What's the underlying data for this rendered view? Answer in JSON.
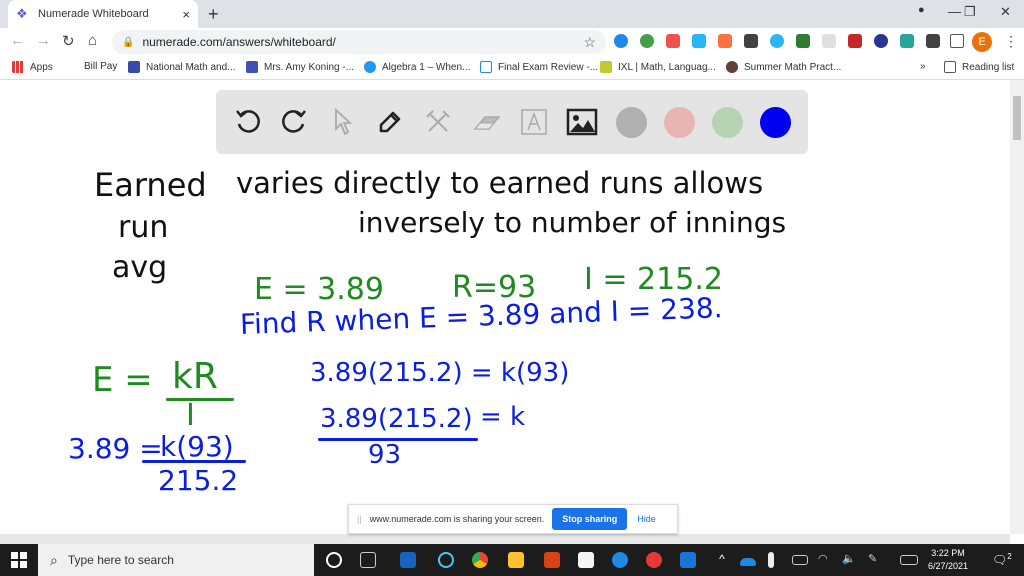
{
  "browser": {
    "tab_title": "Numerade Whiteboard",
    "tab_close": "×",
    "new_tab": "+",
    "url": "numerade.com/answers/whiteboard/",
    "window_controls": {
      "minimize": "—",
      "restore": "❐",
      "close": "✕"
    },
    "profile_initial": "E",
    "icons": {
      "back": "←",
      "forward": "→",
      "reload": "↻",
      "home": "⌂",
      "lock": "🔒",
      "star": "☆",
      "menu": "⋮",
      "media": "●"
    }
  },
  "bookmarks": {
    "items": [
      {
        "label": "Apps",
        "color": "#e53935"
      },
      {
        "label": "Bill Pay",
        "color": ""
      },
      {
        "label": "National Math and...",
        "color": "#3949ab"
      },
      {
        "label": "Mrs. Amy Koning -...",
        "color": "#3f51b5"
      },
      {
        "label": "Algebra 1 – When...",
        "color": "#2196f3"
      },
      {
        "label": "Final Exam Review -...",
        "color": "#1e88e5"
      },
      {
        "label": "IXL | Math, Languag...",
        "color": "#c0ca33"
      },
      {
        "label": "Summer Math Pract...",
        "color": "#5d4037"
      }
    ],
    "overflow": "»",
    "reading_list": "Reading list"
  },
  "whiteboard": {
    "tools": [
      {
        "name": "undo",
        "glyph": "↺",
        "enabled": true
      },
      {
        "name": "redo",
        "glyph": "↻",
        "enabled": true
      },
      {
        "name": "select",
        "glyph": "➚",
        "enabled": false
      },
      {
        "name": "pen",
        "glyph": "✎",
        "enabled": true
      },
      {
        "name": "tools",
        "glyph": "✂",
        "enabled": false
      },
      {
        "name": "eraser",
        "glyph": "▱",
        "enabled": false
      },
      {
        "name": "text",
        "glyph": "A",
        "enabled": false
      },
      {
        "name": "image",
        "glyph": "🖼",
        "enabled": true
      }
    ],
    "colors": [
      "#b0b0b0",
      "#e8b4b4",
      "#b4d4b4",
      "#0000ee"
    ],
    "ink": {
      "line1_a": "Earned",
      "line1_b": "varies directly to earned runs allows",
      "line2_a": "run",
      "line2_b": "inversely to number of innings",
      "line3_a": "avg",
      "given_e": "E = 3.89",
      "given_r": "R=93",
      "given_i": "I = 215.2",
      "find": "Find R when E = 3.89 and I = 238.",
      "formula_lhs": "E =",
      "formula_num": "kR",
      "formula_den": "I",
      "sub_lhs": "3.89 =",
      "sub_num": "k(93)",
      "sub_den": "215.2",
      "step1": "3.89(215.2) = k(93)",
      "step2_num": "3.89(215.2)",
      "step2_rhs": "= k",
      "step2_den": "93"
    }
  },
  "sharebar": {
    "message": "www.numerade.com is sharing your screen.",
    "stop": "Stop sharing",
    "hide": "Hide",
    "grip": "||"
  },
  "taskbar": {
    "search_placeholder": "Type here to search",
    "time": "3:22 PM",
    "date": "6/27/2021",
    "notifications": "2"
  }
}
